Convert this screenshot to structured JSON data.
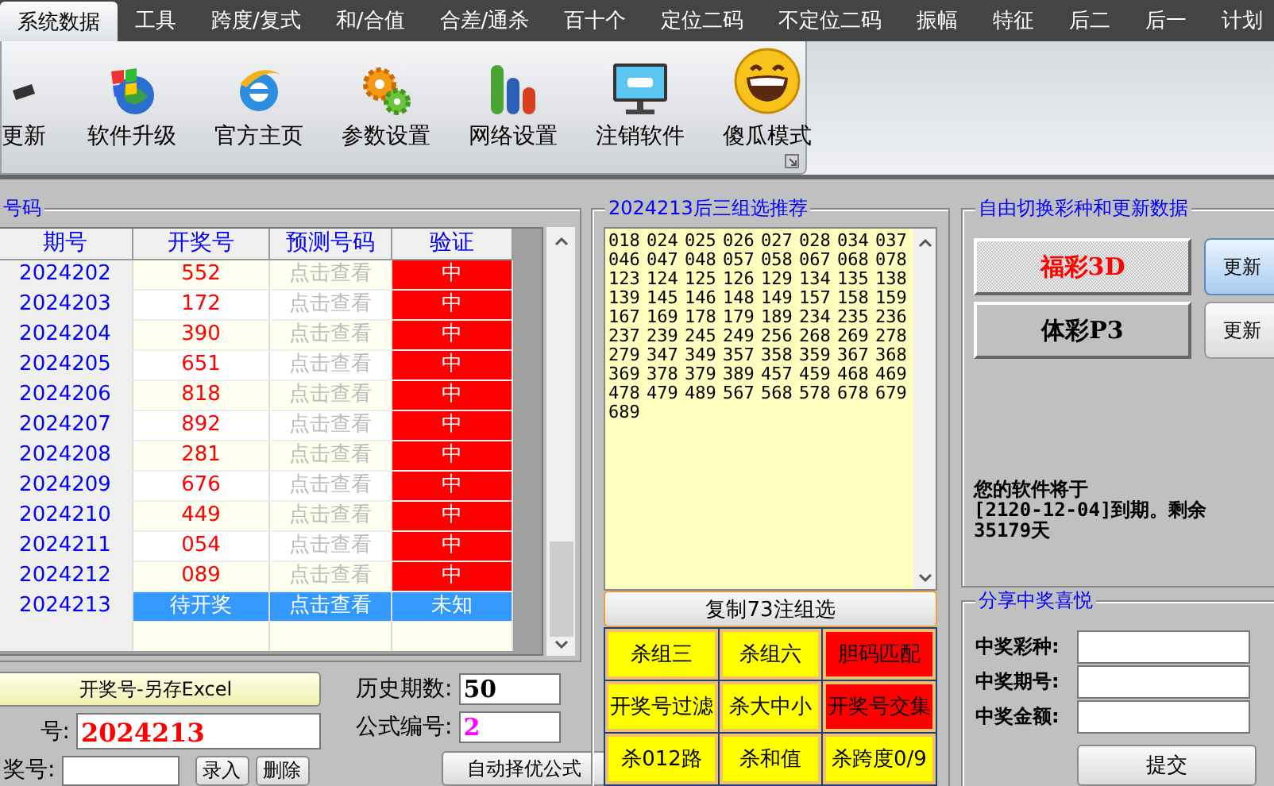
{
  "tabs": [
    {
      "label": "系统数据",
      "selected": true
    },
    {
      "label": "工具",
      "selected": false
    },
    {
      "label": "跨度/复式",
      "selected": false
    },
    {
      "label": "和/合值",
      "selected": false
    },
    {
      "label": "合差/通杀",
      "selected": false
    },
    {
      "label": "百十个",
      "selected": false
    },
    {
      "label": "定位二码",
      "selected": false
    },
    {
      "label": "不定位二码",
      "selected": false
    },
    {
      "label": "振幅",
      "selected": false
    },
    {
      "label": "特征",
      "selected": false
    },
    {
      "label": "后二",
      "selected": false
    },
    {
      "label": "后一",
      "selected": false
    },
    {
      "label": "计划",
      "selected": false
    }
  ],
  "ribbon": [
    {
      "kind": "update",
      "label": "更新"
    },
    {
      "kind": "upgrade",
      "label": "软件升级"
    },
    {
      "kind": "home",
      "label": "官方主页"
    },
    {
      "kind": "params",
      "label": "参数设置"
    },
    {
      "kind": "network",
      "label": "网络设置"
    },
    {
      "kind": "logout",
      "label": "注销软件"
    },
    {
      "kind": "simple",
      "label": "傻瓜模式"
    }
  ],
  "history": {
    "title": "号码",
    "columns": [
      "期号",
      "开奖号",
      "预测号码",
      "验证"
    ],
    "rows": [
      {
        "period": "2024202",
        "number": "552",
        "prediction": "点击查看",
        "result": "中",
        "selected": false
      },
      {
        "period": "2024203",
        "number": "172",
        "prediction": "点击查看",
        "result": "中",
        "selected": false
      },
      {
        "period": "2024204",
        "number": "390",
        "prediction": "点击查看",
        "result": "中",
        "selected": false
      },
      {
        "period": "2024205",
        "number": "651",
        "prediction": "点击查看",
        "result": "中",
        "selected": false
      },
      {
        "period": "2024206",
        "number": "818",
        "prediction": "点击查看",
        "result": "中",
        "selected": false
      },
      {
        "period": "2024207",
        "number": "892",
        "prediction": "点击查看",
        "result": "中",
        "selected": false
      },
      {
        "period": "2024208",
        "number": "281",
        "prediction": "点击查看",
        "result": "中",
        "selected": false
      },
      {
        "period": "2024209",
        "number": "676",
        "prediction": "点击查看",
        "result": "中",
        "selected": false
      },
      {
        "period": "2024210",
        "number": "449",
        "prediction": "点击查看",
        "result": "中",
        "selected": false
      },
      {
        "period": "2024211",
        "number": "054",
        "prediction": "点击查看",
        "result": "中",
        "selected": false
      },
      {
        "period": "2024212",
        "number": "089",
        "prediction": "点击查看",
        "result": "中",
        "selected": false
      },
      {
        "period": "2024213",
        "number": "待开奖",
        "prediction": "点击查看",
        "result": "未知",
        "selected": true
      }
    ]
  },
  "excel_button": "开奖号-另存Excel",
  "history_count": {
    "label": "历史期数:",
    "value": "50"
  },
  "formula_no": {
    "label": "公式编号:",
    "value": "2"
  },
  "issue": {
    "label": "号:",
    "value": "2024213"
  },
  "draw_entry": {
    "label": "奖号:",
    "buttons": [
      "录入",
      "删除"
    ]
  },
  "auto_button": "自动择优公式",
  "recommend": {
    "title": "2024213后三组选推荐",
    "numbers": [
      "018",
      "024",
      "025",
      "026",
      "027",
      "028",
      "034",
      "037",
      "046",
      "047",
      "048",
      "057",
      "058",
      "067",
      "068",
      "078",
      "123",
      "124",
      "125",
      "126",
      "129",
      "134",
      "135",
      "138",
      "139",
      "145",
      "146",
      "148",
      "149",
      "157",
      "158",
      "159",
      "167",
      "169",
      "178",
      "179",
      "189",
      "234",
      "235",
      "236",
      "237",
      "239",
      "245",
      "249",
      "256",
      "268",
      "269",
      "278",
      "279",
      "347",
      "349",
      "357",
      "358",
      "359",
      "367",
      "368",
      "369",
      "378",
      "379",
      "389",
      "457",
      "459",
      "468",
      "469",
      "478",
      "479",
      "489",
      "567",
      "568",
      "578",
      "678",
      "679",
      "689"
    ],
    "copy_button": "复制73注组选",
    "filters": [
      {
        "label": "杀组三",
        "color": "#ffff00"
      },
      {
        "label": "杀组六",
        "color": "#ffff00"
      },
      {
        "label": "胆码匹配",
        "color": "#ff0000"
      },
      {
        "label": "开奖号过滤",
        "color": "#ffff00"
      },
      {
        "label": "杀大中小",
        "color": "#ffff00"
      },
      {
        "label": "开奖号交集",
        "color": "#ff0000"
      },
      {
        "label": "杀012路",
        "color": "#ffff00"
      },
      {
        "label": "杀和值",
        "color": "#ffff00"
      },
      {
        "label": "杀跨度0/9",
        "color": "#ffff00"
      }
    ]
  },
  "switcher": {
    "title": "自由切换彩种和更新数据",
    "lotteries": [
      {
        "name": "福彩3D",
        "selected": true,
        "update": "更新"
      },
      {
        "name": "体彩P3",
        "selected": false,
        "update": "更新"
      }
    ],
    "expiry": "您的软件将于\n[2120-12-04]到期。剩余\n35179天"
  },
  "share": {
    "title": "分享中奖喜悦",
    "fields": [
      {
        "label": "中奖彩种:"
      },
      {
        "label": "中奖期号:"
      },
      {
        "label": "中奖金额:"
      }
    ],
    "submit": "提交"
  }
}
